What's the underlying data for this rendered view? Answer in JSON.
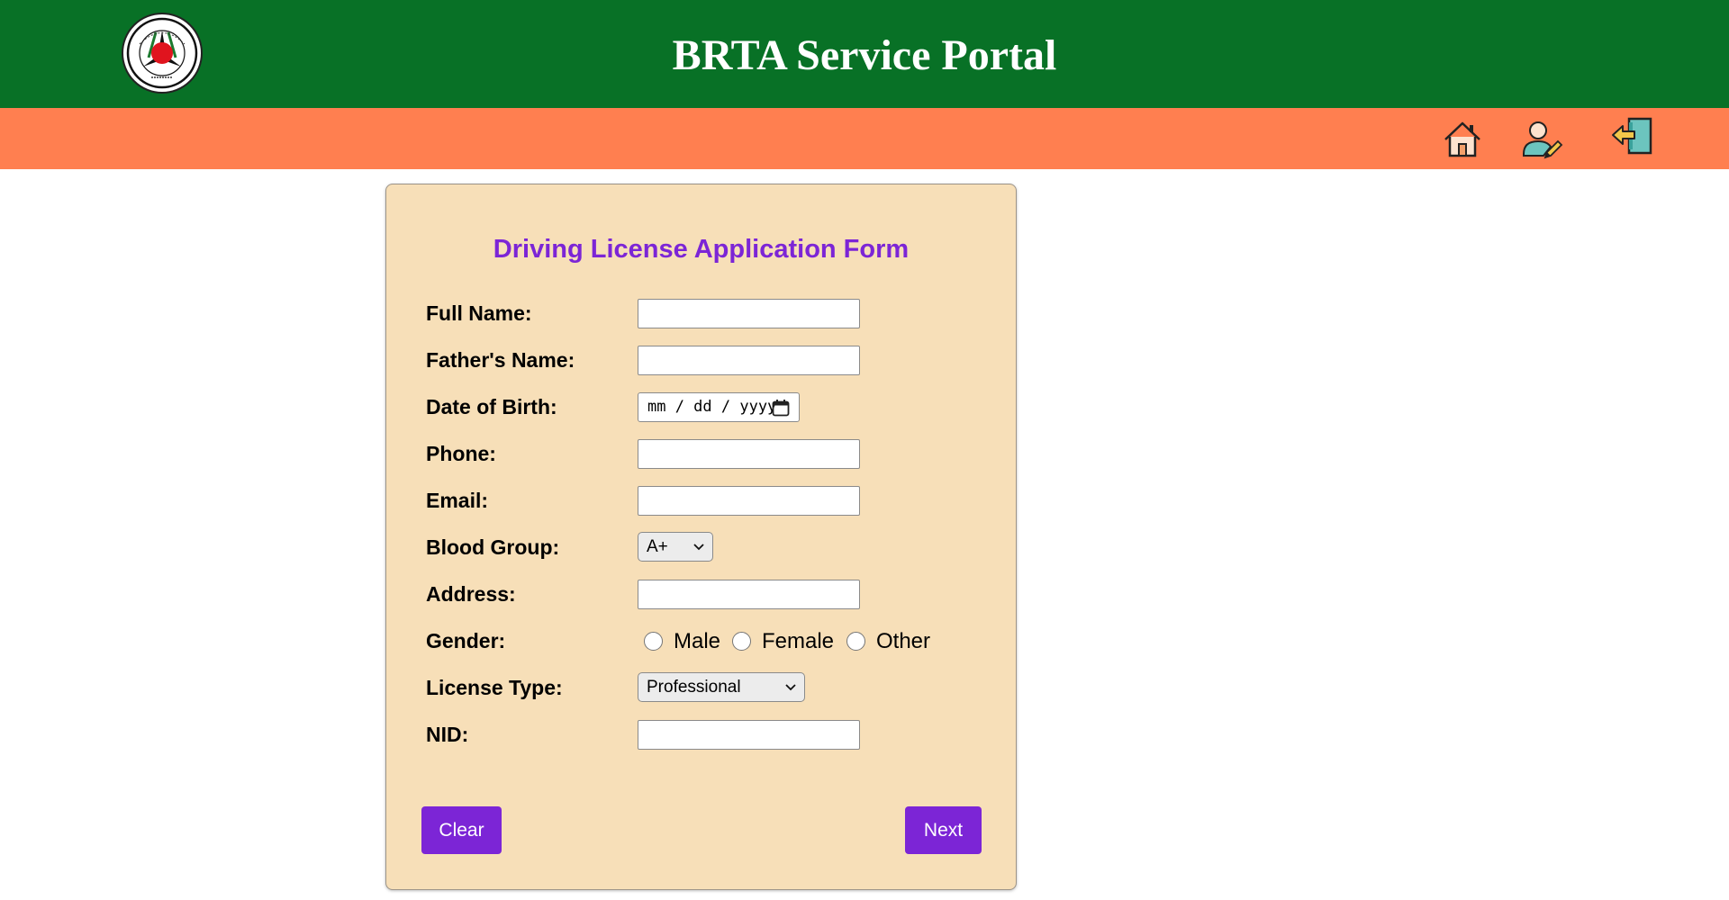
{
  "header": {
    "title": "BRTA Service Portal",
    "brand_color": "#087126"
  },
  "navbar": {
    "color": "#ff7f50",
    "icons": [
      "home-icon",
      "user-edit-icon",
      "logout-icon"
    ]
  },
  "form": {
    "title": "Driving License Application Form",
    "accent_color": "#7c25d6",
    "fields": {
      "full_name": {
        "label": "Full Name:",
        "value": ""
      },
      "father_name": {
        "label": "Father's Name:",
        "value": ""
      },
      "dob": {
        "label": "Date of Birth:",
        "placeholder": "mm / dd / yyyy"
      },
      "phone": {
        "label": "Phone:",
        "value": ""
      },
      "email": {
        "label": "Email:",
        "value": ""
      },
      "blood_group": {
        "label": "Blood Group:",
        "selected": "A+"
      },
      "address": {
        "label": "Address:",
        "value": ""
      },
      "gender": {
        "label": "Gender:",
        "options": [
          "Male",
          "Female",
          "Other"
        ]
      },
      "license_type": {
        "label": "License Type:",
        "selected": "Professional"
      },
      "nid": {
        "label": "NID:",
        "value": ""
      }
    },
    "buttons": {
      "clear": "Clear",
      "next": "Next"
    }
  }
}
